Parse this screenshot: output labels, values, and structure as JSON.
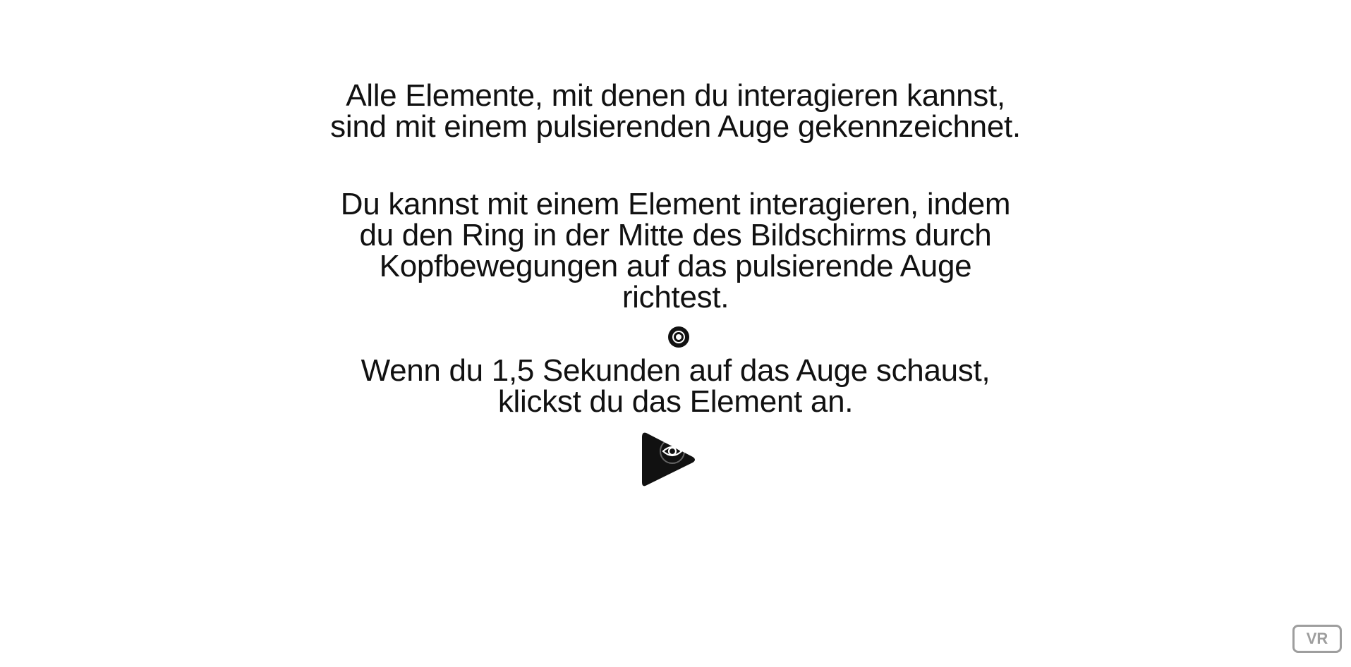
{
  "instructions": {
    "paragraph1": [
      "Alle Elemente, mit denen du interagieren kannst,",
      "sind mit einem pulsierenden Auge gekennzeichnet."
    ],
    "paragraph2": [
      "Du kannst mit einem Element interagieren, indem",
      "du den Ring in der Mitte des Bildschirms durch",
      "Kopfbewegungen auf das pulsierende Auge",
      "richtest."
    ],
    "paragraph3": [
      "Wenn du 1,5 Sekunden auf das Auge schaust,",
      "klickst du das Element an."
    ]
  },
  "icons": {
    "cursor": "gaze-ring-icon",
    "play": "play-icon",
    "eye": "eye-icon"
  },
  "vr_button": {
    "label": "VR"
  },
  "colors": {
    "background": "#ffffff",
    "text": "#111111",
    "vr_button": "#9e9e9e"
  }
}
